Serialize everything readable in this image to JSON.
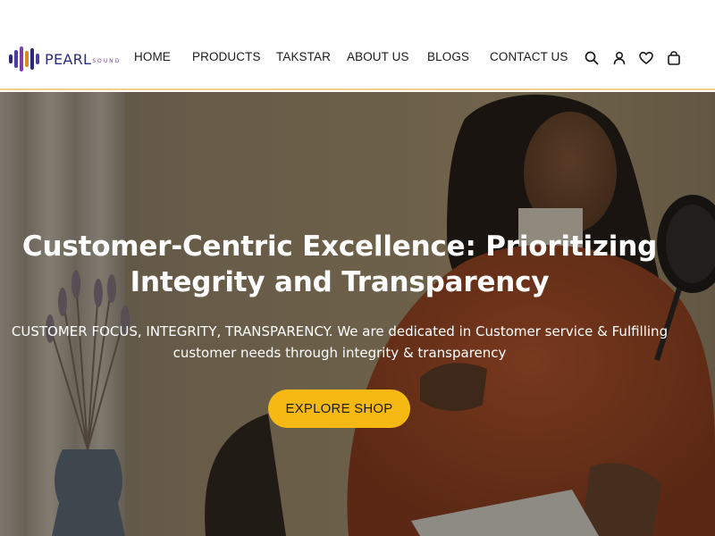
{
  "brand": {
    "name": "PEARL",
    "tagline": "SOUND",
    "logo_icon": "sound-wave-bars-icon",
    "logo_colors": [
      "#2a2a7d",
      "#4a3fa0",
      "#7b3fb0",
      "#e08a1e",
      "#2a2a7d",
      "#4a3fa0"
    ]
  },
  "nav": {
    "items": [
      {
        "label": "HOME"
      },
      {
        "label": "PRODUCTS"
      },
      {
        "label": "TAKSTAR"
      },
      {
        "label": "ABOUT US"
      },
      {
        "label": "BLOGS"
      },
      {
        "label": "CONTACT US"
      }
    ]
  },
  "header_icons": [
    {
      "name": "search-icon"
    },
    {
      "name": "account-icon"
    },
    {
      "name": "wishlist-heart-icon"
    },
    {
      "name": "cart-bag-icon"
    }
  ],
  "hero": {
    "title_line1": "Customer-Centric Excellence: Prioritizing",
    "title_line2": "Integrity and Transparency",
    "subtitle_line1": "CUSTOMER FOCUS, INTEGRITY, TRANSPARENCY. We are dedicated in Customer service & Fulfilling",
    "subtitle_line2": "customer needs through integrity & transparency",
    "cta_label": "EXPLORE SHOP"
  },
  "colors": {
    "accent": "#f6b914",
    "header_border": "#f2d08a",
    "text_dark": "#1a1a1a"
  }
}
